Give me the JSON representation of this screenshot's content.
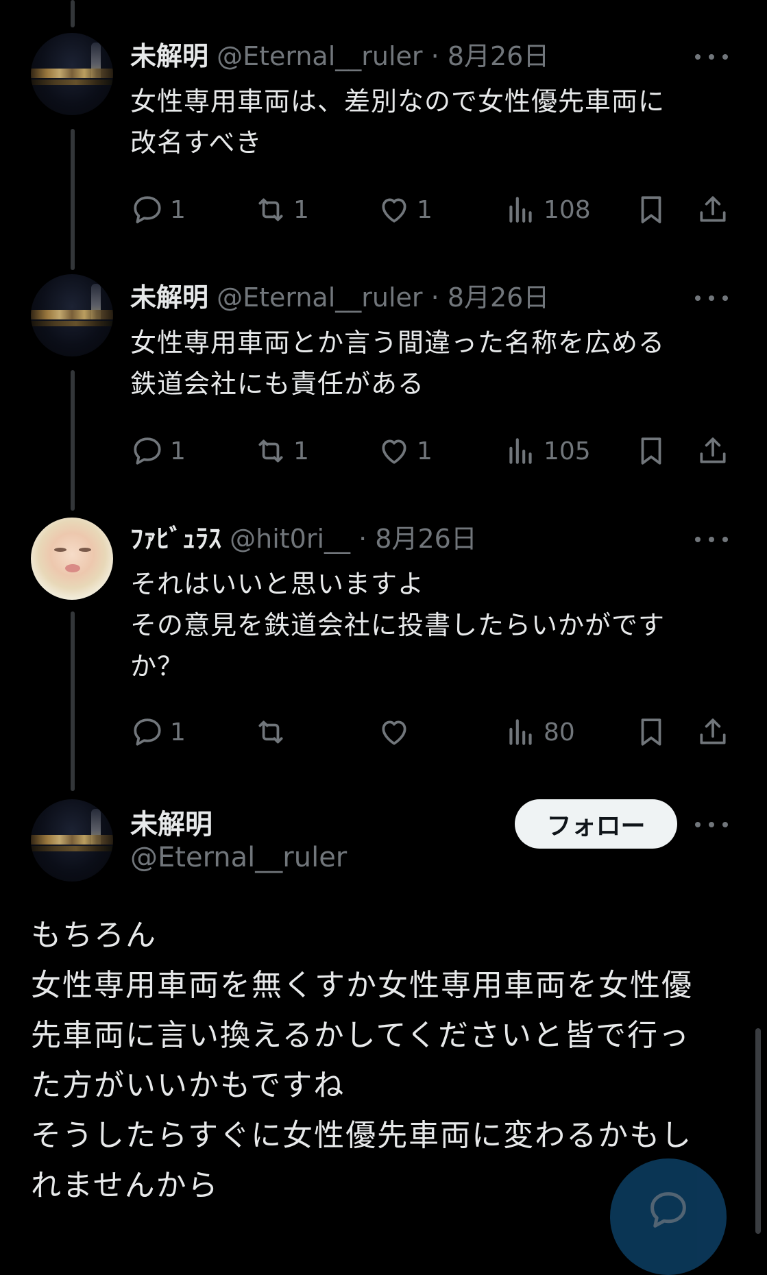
{
  "thread": [
    {
      "name": "未解明",
      "handle": "@Eternal__ruler",
      "separator": "·",
      "date": "8月26日",
      "text": "女性専用車両は、差別なので女性優先車両に\n改名すべき",
      "replies": "1",
      "reposts": "1",
      "likes": "1",
      "views": "108",
      "avatar": "night-city-avatar"
    },
    {
      "name": "未解明",
      "handle": "@Eternal__ruler",
      "separator": "·",
      "date": "8月26日",
      "text": "女性専用車両とか言う間違った名称を広める\n鉄道会社にも責任がある",
      "replies": "1",
      "reposts": "1",
      "likes": "1",
      "views": "105",
      "avatar": "night-city-avatar"
    },
    {
      "name": "ﾌｧﾋﾞｭﾗｽ",
      "handle": "@hit0ri__",
      "separator": "·",
      "date": "8月26日",
      "text": "それはいいと思いますよ\nその意見を鉄道会社に投書したらいかがです\nか？",
      "replies": "1",
      "reposts": "",
      "likes": "",
      "views": "80",
      "avatar": "portrait-avatar"
    }
  ],
  "main_tweet": {
    "name": "未解明",
    "handle": "@Eternal__ruler",
    "follow_label": "フォロー",
    "text": "もちろん\n女性専用車両を無くすか女性専用車両を女性優\n先車両に言い換えるかしてくださいと皆で行っ\nた方がいいかもですね\nそうしたらすぐに女性優先車両に変わるかもし\nれませんから"
  },
  "icons": {
    "reply": "reply-icon",
    "repost": "repost-icon",
    "like": "heart-icon",
    "views": "views-icon",
    "bookmark": "bookmark-icon",
    "share": "share-icon",
    "more": "more-icon",
    "compose": "compose-reply-icon"
  },
  "colors": {
    "background": "#000000",
    "text": "#e7e9ea",
    "muted": "#71767b",
    "follow_button_bg": "#eff3f4",
    "fab": "#0c3b5e"
  }
}
